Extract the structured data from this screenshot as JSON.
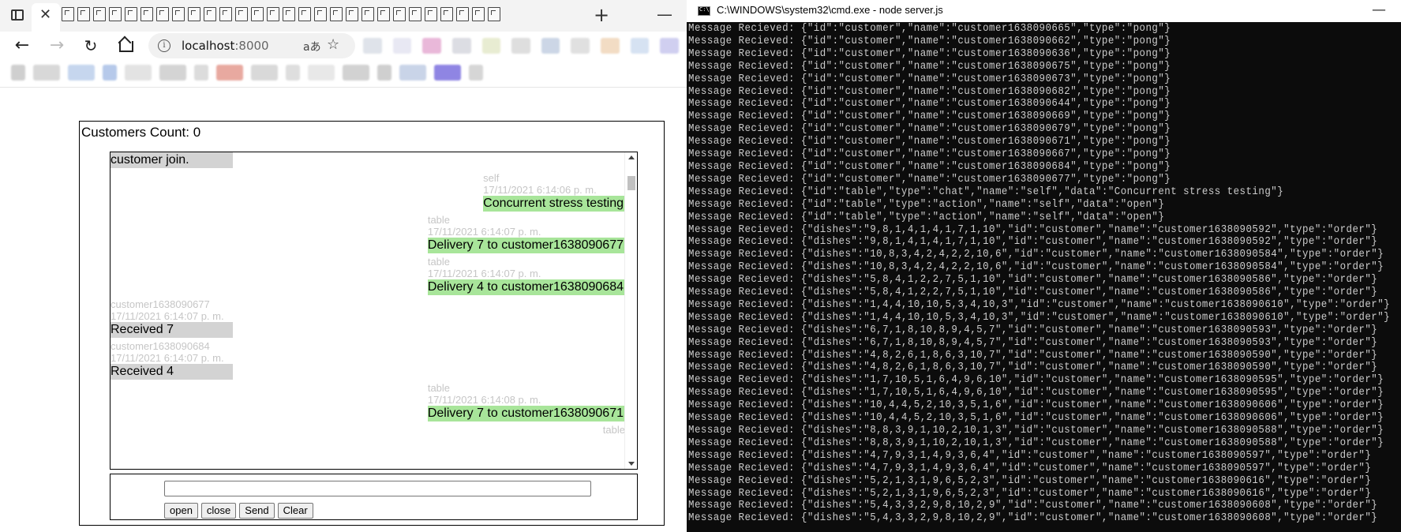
{
  "browser": {
    "new_tab_label": "+",
    "close_tab_label": "✕",
    "minimize_label": "—",
    "url_host": "localhost",
    "url_port": ":8000",
    "read_aloud_label": "aあ"
  },
  "page": {
    "customers_count": "Customers Count: 0",
    "messages": [
      {
        "side": "left",
        "meta_name": "",
        "meta_time": "",
        "text": "customer join."
      },
      {
        "side": "right",
        "meta_name": "self",
        "meta_time": "17/11/2021 6:14:06 p. m.",
        "text": "Concurrent stress testing"
      },
      {
        "side": "right",
        "meta_name": "table",
        "meta_time": "17/11/2021 6:14:07 p. m.",
        "text": "Delivery 7 to customer1638090677"
      },
      {
        "side": "right",
        "meta_name": "table",
        "meta_time": "17/11/2021 6:14:07 p. m.",
        "text": "Delivery 4 to customer1638090684"
      },
      {
        "side": "left",
        "meta_name": "customer1638090677",
        "meta_time": "17/11/2021 6:14:07 p. m.",
        "text": "Received 7"
      },
      {
        "side": "left",
        "meta_name": "customer1638090684",
        "meta_time": "17/11/2021 6:14:07 p. m.",
        "text": "Received 4"
      },
      {
        "side": "right",
        "meta_name": "table",
        "meta_time": "17/11/2021 6:14:08 p. m.",
        "text": "Delivery 7 to customer1638090671"
      },
      {
        "side": "right",
        "meta_name": "table",
        "meta_time": "",
        "text": ""
      }
    ],
    "input_value": "",
    "buttons": {
      "open": "open",
      "close": "close",
      "send": "Send",
      "clear": "Clear"
    }
  },
  "cmd": {
    "title": "C:\\WINDOWS\\system32\\cmd.exe - node  server.js",
    "minimize_label": "—",
    "lines": [
      "Message Recieved: {\"id\":\"customer\",\"name\":\"customer1638090665\",\"type\":\"pong\"}",
      "Message Recieved: {\"id\":\"customer\",\"name\":\"customer1638090662\",\"type\":\"pong\"}",
      "Message Recieved: {\"id\":\"customer\",\"name\":\"customer1638090636\",\"type\":\"pong\"}",
      "Message Recieved: {\"id\":\"customer\",\"name\":\"customer1638090675\",\"type\":\"pong\"}",
      "Message Recieved: {\"id\":\"customer\",\"name\":\"customer1638090673\",\"type\":\"pong\"}",
      "Message Recieved: {\"id\":\"customer\",\"name\":\"customer1638090682\",\"type\":\"pong\"}",
      "Message Recieved: {\"id\":\"customer\",\"name\":\"customer1638090644\",\"type\":\"pong\"}",
      "Message Recieved: {\"id\":\"customer\",\"name\":\"customer1638090669\",\"type\":\"pong\"}",
      "Message Recieved: {\"id\":\"customer\",\"name\":\"customer1638090679\",\"type\":\"pong\"}",
      "Message Recieved: {\"id\":\"customer\",\"name\":\"customer1638090671\",\"type\":\"pong\"}",
      "Message Recieved: {\"id\":\"customer\",\"name\":\"customer1638090667\",\"type\":\"pong\"}",
      "Message Recieved: {\"id\":\"customer\",\"name\":\"customer1638090684\",\"type\":\"pong\"}",
      "Message Recieved: {\"id\":\"customer\",\"name\":\"customer1638090677\",\"type\":\"pong\"}",
      "Message Recieved: {\"id\":\"table\",\"type\":\"chat\",\"name\":\"self\",\"data\":\"Concurrent stress testing\"}",
      "Message Recieved: {\"id\":\"table\",\"type\":\"action\",\"name\":\"self\",\"data\":\"open\"}",
      "Message Recieved: {\"id\":\"table\",\"type\":\"action\",\"name\":\"self\",\"data\":\"open\"}",
      "Message Recieved: {\"dishes\":\"9,8,1,4,1,4,1,7,1,10\",\"id\":\"customer\",\"name\":\"customer1638090592\",\"type\":\"order\"}",
      "Message Recieved: {\"dishes\":\"9,8,1,4,1,4,1,7,1,10\",\"id\":\"customer\",\"name\":\"customer1638090592\",\"type\":\"order\"}",
      "Message Recieved: {\"dishes\":\"10,8,3,4,2,4,2,2,10,6\",\"id\":\"customer\",\"name\":\"customer1638090584\",\"type\":\"order\"}",
      "Message Recieved: {\"dishes\":\"10,8,3,4,2,4,2,2,10,6\",\"id\":\"customer\",\"name\":\"customer1638090584\",\"type\":\"order\"}",
      "Message Recieved: {\"dishes\":\"5,8,4,1,2,2,7,5,1,10\",\"id\":\"customer\",\"name\":\"customer1638090586\",\"type\":\"order\"}",
      "Message Recieved: {\"dishes\":\"5,8,4,1,2,2,7,5,1,10\",\"id\":\"customer\",\"name\":\"customer1638090586\",\"type\":\"order\"}",
      "Message Recieved: {\"dishes\":\"1,4,4,10,10,5,3,4,10,3\",\"id\":\"customer\",\"name\":\"customer1638090610\",\"type\":\"order\"}",
      "Message Recieved: {\"dishes\":\"1,4,4,10,10,5,3,4,10,3\",\"id\":\"customer\",\"name\":\"customer1638090610\",\"type\":\"order\"}",
      "Message Recieved: {\"dishes\":\"6,7,1,8,10,8,9,4,5,7\",\"id\":\"customer\",\"name\":\"customer1638090593\",\"type\":\"order\"}",
      "Message Recieved: {\"dishes\":\"6,7,1,8,10,8,9,4,5,7\",\"id\":\"customer\",\"name\":\"customer1638090593\",\"type\":\"order\"}",
      "Message Recieved: {\"dishes\":\"4,8,2,6,1,8,6,3,10,7\",\"id\":\"customer\",\"name\":\"customer1638090590\",\"type\":\"order\"}",
      "Message Recieved: {\"dishes\":\"4,8,2,6,1,8,6,3,10,7\",\"id\":\"customer\",\"name\":\"customer1638090590\",\"type\":\"order\"}",
      "Message Recieved: {\"dishes\":\"1,7,10,5,1,6,4,9,6,10\",\"id\":\"customer\",\"name\":\"customer1638090595\",\"type\":\"order\"}",
      "Message Recieved: {\"dishes\":\"1,7,10,5,1,6,4,9,6,10\",\"id\":\"customer\",\"name\":\"customer1638090595\",\"type\":\"order\"}",
      "Message Recieved: {\"dishes\":\"10,4,4,5,2,10,3,5,1,6\",\"id\":\"customer\",\"name\":\"customer1638090606\",\"type\":\"order\"}",
      "Message Recieved: {\"dishes\":\"10,4,4,5,2,10,3,5,1,6\",\"id\":\"customer\",\"name\":\"customer1638090606\",\"type\":\"order\"}",
      "Message Recieved: {\"dishes\":\"8,8,3,9,1,10,2,10,1,3\",\"id\":\"customer\",\"name\":\"customer1638090588\",\"type\":\"order\"}",
      "Message Recieved: {\"dishes\":\"8,8,3,9,1,10,2,10,1,3\",\"id\":\"customer\",\"name\":\"customer1638090588\",\"type\":\"order\"}",
      "Message Recieved: {\"dishes\":\"4,7,9,3,1,4,9,3,6,4\",\"id\":\"customer\",\"name\":\"customer1638090597\",\"type\":\"order\"}",
      "Message Recieved: {\"dishes\":\"4,7,9,3,1,4,9,3,6,4\",\"id\":\"customer\",\"name\":\"customer1638090597\",\"type\":\"order\"}",
      "Message Recieved: {\"dishes\":\"5,2,1,3,1,9,6,5,2,3\",\"id\":\"customer\",\"name\":\"customer1638090616\",\"type\":\"order\"}",
      "Message Recieved: {\"dishes\":\"5,2,1,3,1,9,6,5,2,3\",\"id\":\"customer\",\"name\":\"customer1638090616\",\"type\":\"order\"}",
      "Message Recieved: {\"dishes\":\"5,4,3,3,2,9,8,10,2,9\",\"id\":\"customer\",\"name\":\"customer1638090608\",\"type\":\"order\"}",
      "Message Recieved: {\"dishes\":\"5,4,3,3,2,9,8,10,2,9\",\"id\":\"customer\",\"name\":\"customer1638090608\",\"type\":\"order\"}"
    ]
  },
  "colors": {
    "self_bubble": "#a8e59a",
    "other_bubble": "#d3d3d3",
    "meta_text": "#c6c6c6",
    "console_bg": "#0c0c0c",
    "console_text": "#cccccc"
  }
}
